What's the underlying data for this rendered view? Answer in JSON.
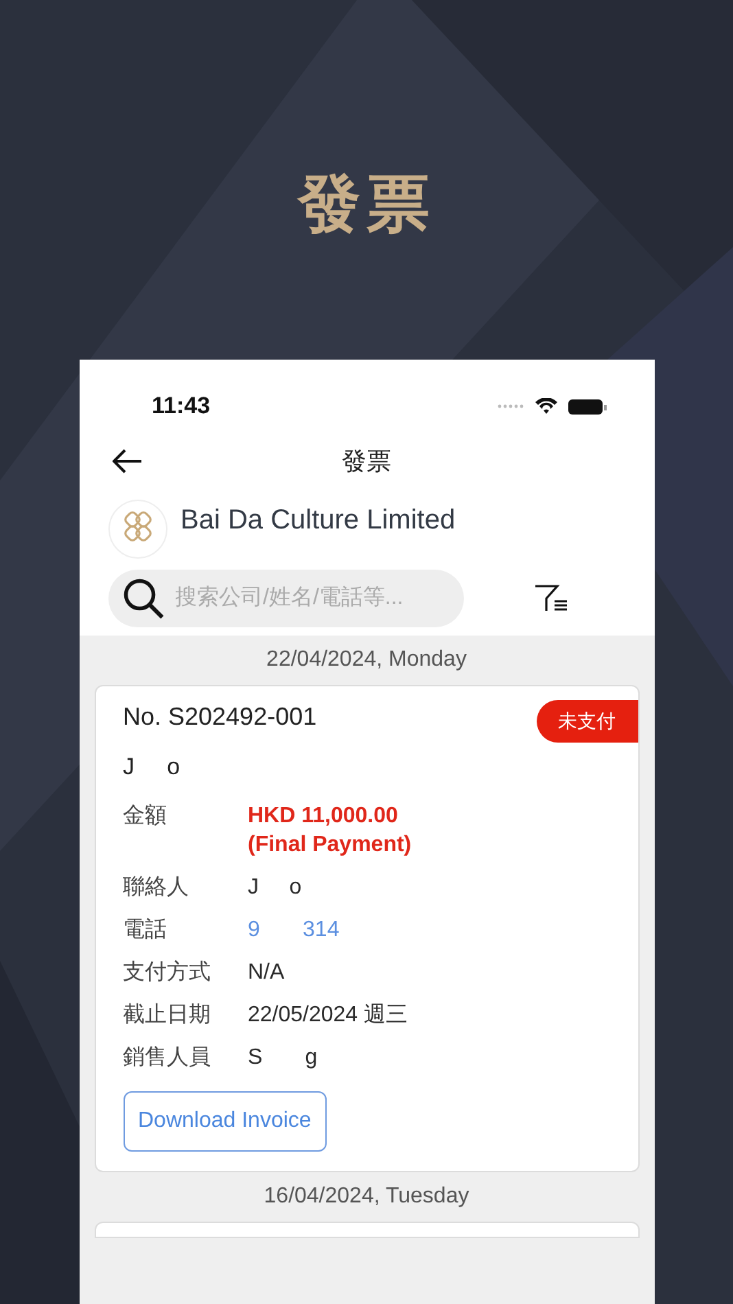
{
  "headline": "發票",
  "status_bar": {
    "time": "11:43"
  },
  "nav": {
    "title": "發票"
  },
  "company": {
    "name": "Bai Da Culture Limited"
  },
  "search": {
    "placeholder": "搜索公司/姓名/電話等..."
  },
  "groups": [
    {
      "date": "22/04/2024, Monday",
      "invoices": [
        {
          "number": "No. S202492-001",
          "status": "未支付",
          "paid": false,
          "customer": "J     o",
          "fields": [
            {
              "label": "金額",
              "kind": "amount",
              "lines": [
                "HKD 11,000.00",
                "(Final Payment)"
              ]
            },
            {
              "label": "聯絡人",
              "kind": "text",
              "lines": [
                "J     o"
              ]
            },
            {
              "label": "電話",
              "kind": "link",
              "lines": [
                "9       314"
              ]
            },
            {
              "label": "支付方式",
              "kind": "text",
              "lines": [
                "N/A"
              ]
            },
            {
              "label": "截止日期",
              "kind": "text",
              "lines": [
                "22/05/2024 週三"
              ]
            },
            {
              "label": "銷售人員",
              "kind": "text",
              "lines": [
                "S       g"
              ]
            }
          ],
          "button": "Download Invoice"
        }
      ]
    },
    {
      "date": "16/04/2024, Tuesday"
    }
  ]
}
